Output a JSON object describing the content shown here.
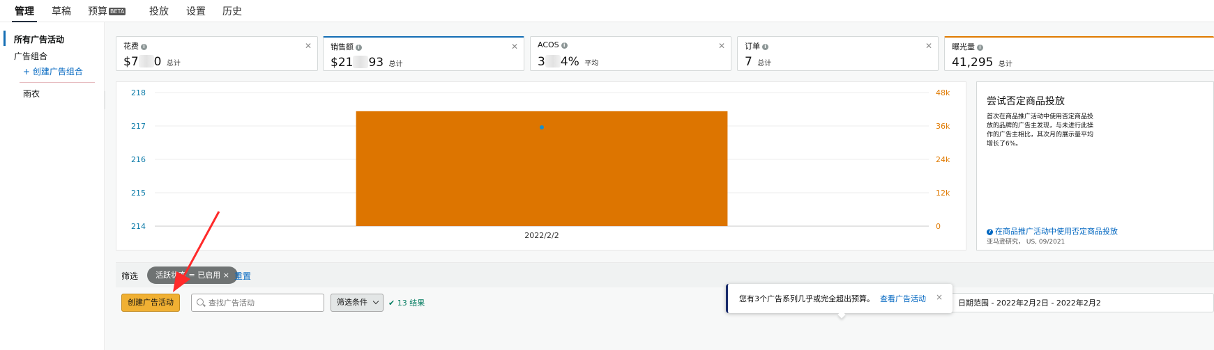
{
  "nav": {
    "tabs": [
      {
        "label": "管理",
        "active": true
      },
      {
        "label": "草稿"
      },
      {
        "label": "预算",
        "badge": "BETA"
      },
      {
        "label": "投放"
      },
      {
        "label": "设置"
      },
      {
        "label": "历史"
      }
    ]
  },
  "sidebar": {
    "all_campaigns": "所有广告活动",
    "portfolios": "广告组合",
    "create_portfolio": "+ 创建广告组合",
    "portfolio_item": "雨衣",
    "collapse_glyph": "«"
  },
  "metrics": [
    {
      "label": "花费",
      "value_prefix": "$7",
      "value_suffix": "0",
      "sub": "总计",
      "selected": false
    },
    {
      "label": "销售额",
      "value_prefix": "$21",
      "value_suffix": "93",
      "sub": "总计",
      "selected": "blue"
    },
    {
      "label": "ACOS",
      "value_prefix": "3",
      "value_suffix": "4%",
      "sub": "平均",
      "selected": false
    },
    {
      "label": "订单",
      "value_prefix": "7",
      "value_suffix": "",
      "sub": "总计",
      "selected": false
    },
    {
      "label": "曝光量",
      "value_prefix": "41,295",
      "value_suffix": "",
      "sub": "总计",
      "selected": "orange"
    }
  ],
  "chart_data": {
    "type": "bar",
    "categories": [
      "2022/2/2"
    ],
    "series": [
      {
        "axis": "right",
        "color": "#dd7500",
        "values": [
          41295
        ],
        "kind": "bar"
      },
      {
        "axis": "left",
        "color": "#1a8fc7",
        "values": [
          217
        ],
        "kind": "point"
      }
    ],
    "left_axis": {
      "ticks": [
        "218",
        "217",
        "216",
        "215",
        "214"
      ],
      "ylim": [
        214,
        218
      ],
      "color": "#0a7aa8"
    },
    "right_axis": {
      "ticks": [
        "48k",
        "36k",
        "24k",
        "12k",
        "0"
      ],
      "ylim": [
        0,
        48000
      ],
      "color": "#e07a00"
    },
    "grid": true
  },
  "tip": {
    "title": "尝试否定商品投放",
    "body": "首次在商品推广活动中使用否定商品投放的品牌的广告主发现，与未进行此操作的广告主相比，其次月的展示量平均增长了6%。",
    "link": "在商品推广活动中使用否定商品投放",
    "source": "亚马逊研究， US, 09/2021"
  },
  "filter": {
    "label": "筛选",
    "chip": "活跃状态 = 已启用",
    "chip_close": "×",
    "reset": "重置"
  },
  "actions": {
    "create": "创建广告活动",
    "search_placeholder": "查找广告活动",
    "filter_button": "筛选条件",
    "results": "✔ 13 结果",
    "date_range": "日期范围 - 2022年2月2日 - 2022年2月2"
  },
  "toast": {
    "text": "您有3个广告系列几乎或完全超出预算。",
    "link": "查看广告活动",
    "close": "×"
  },
  "colors": {
    "accent_blue": "#146eb4",
    "bar_orange": "#dd7500",
    "button_yellow": "#f0b033",
    "annotation_red": "#ff2a2a"
  }
}
